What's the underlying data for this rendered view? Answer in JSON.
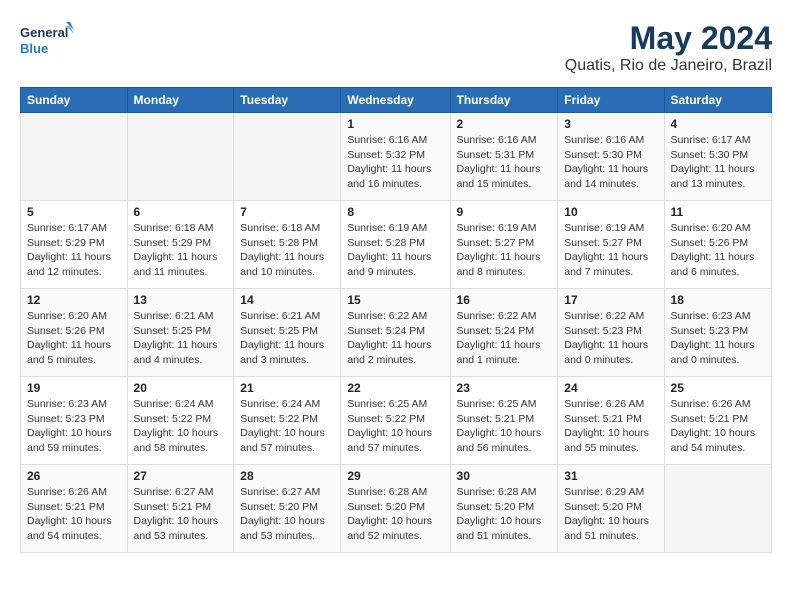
{
  "logo": {
    "line1": "General",
    "line2": "Blue"
  },
  "header": {
    "title": "May 2024",
    "subtitle": "Quatis, Rio de Janeiro, Brazil"
  },
  "calendar": {
    "days_of_week": [
      "Sunday",
      "Monday",
      "Tuesday",
      "Wednesday",
      "Thursday",
      "Friday",
      "Saturday"
    ],
    "weeks": [
      [
        {
          "day": "",
          "info": ""
        },
        {
          "day": "",
          "info": ""
        },
        {
          "day": "",
          "info": ""
        },
        {
          "day": "1",
          "info": "Sunrise: 6:16 AM\nSunset: 5:32 PM\nDaylight: 11 hours and 16 minutes."
        },
        {
          "day": "2",
          "info": "Sunrise: 6:16 AM\nSunset: 5:31 PM\nDaylight: 11 hours and 15 minutes."
        },
        {
          "day": "3",
          "info": "Sunrise: 6:16 AM\nSunset: 5:30 PM\nDaylight: 11 hours and 14 minutes."
        },
        {
          "day": "4",
          "info": "Sunrise: 6:17 AM\nSunset: 5:30 PM\nDaylight: 11 hours and 13 minutes."
        }
      ],
      [
        {
          "day": "5",
          "info": "Sunrise: 6:17 AM\nSunset: 5:29 PM\nDaylight: 11 hours and 12 minutes."
        },
        {
          "day": "6",
          "info": "Sunrise: 6:18 AM\nSunset: 5:29 PM\nDaylight: 11 hours and 11 minutes."
        },
        {
          "day": "7",
          "info": "Sunrise: 6:18 AM\nSunset: 5:28 PM\nDaylight: 11 hours and 10 minutes."
        },
        {
          "day": "8",
          "info": "Sunrise: 6:19 AM\nSunset: 5:28 PM\nDaylight: 11 hours and 9 minutes."
        },
        {
          "day": "9",
          "info": "Sunrise: 6:19 AM\nSunset: 5:27 PM\nDaylight: 11 hours and 8 minutes."
        },
        {
          "day": "10",
          "info": "Sunrise: 6:19 AM\nSunset: 5:27 PM\nDaylight: 11 hours and 7 minutes."
        },
        {
          "day": "11",
          "info": "Sunrise: 6:20 AM\nSunset: 5:26 PM\nDaylight: 11 hours and 6 minutes."
        }
      ],
      [
        {
          "day": "12",
          "info": "Sunrise: 6:20 AM\nSunset: 5:26 PM\nDaylight: 11 hours and 5 minutes."
        },
        {
          "day": "13",
          "info": "Sunrise: 6:21 AM\nSunset: 5:25 PM\nDaylight: 11 hours and 4 minutes."
        },
        {
          "day": "14",
          "info": "Sunrise: 6:21 AM\nSunset: 5:25 PM\nDaylight: 11 hours and 3 minutes."
        },
        {
          "day": "15",
          "info": "Sunrise: 6:22 AM\nSunset: 5:24 PM\nDaylight: 11 hours and 2 minutes."
        },
        {
          "day": "16",
          "info": "Sunrise: 6:22 AM\nSunset: 5:24 PM\nDaylight: 11 hours and 1 minute."
        },
        {
          "day": "17",
          "info": "Sunrise: 6:22 AM\nSunset: 5:23 PM\nDaylight: 11 hours and 0 minutes."
        },
        {
          "day": "18",
          "info": "Sunrise: 6:23 AM\nSunset: 5:23 PM\nDaylight: 11 hours and 0 minutes."
        }
      ],
      [
        {
          "day": "19",
          "info": "Sunrise: 6:23 AM\nSunset: 5:23 PM\nDaylight: 10 hours and 59 minutes."
        },
        {
          "day": "20",
          "info": "Sunrise: 6:24 AM\nSunset: 5:22 PM\nDaylight: 10 hours and 58 minutes."
        },
        {
          "day": "21",
          "info": "Sunrise: 6:24 AM\nSunset: 5:22 PM\nDaylight: 10 hours and 57 minutes."
        },
        {
          "day": "22",
          "info": "Sunrise: 6:25 AM\nSunset: 5:22 PM\nDaylight: 10 hours and 57 minutes."
        },
        {
          "day": "23",
          "info": "Sunrise: 6:25 AM\nSunset: 5:21 PM\nDaylight: 10 hours and 56 minutes."
        },
        {
          "day": "24",
          "info": "Sunrise: 6:26 AM\nSunset: 5:21 PM\nDaylight: 10 hours and 55 minutes."
        },
        {
          "day": "25",
          "info": "Sunrise: 6:26 AM\nSunset: 5:21 PM\nDaylight: 10 hours and 54 minutes."
        }
      ],
      [
        {
          "day": "26",
          "info": "Sunrise: 6:26 AM\nSunset: 5:21 PM\nDaylight: 10 hours and 54 minutes."
        },
        {
          "day": "27",
          "info": "Sunrise: 6:27 AM\nSunset: 5:21 PM\nDaylight: 10 hours and 53 minutes."
        },
        {
          "day": "28",
          "info": "Sunrise: 6:27 AM\nSunset: 5:20 PM\nDaylight: 10 hours and 53 minutes."
        },
        {
          "day": "29",
          "info": "Sunrise: 6:28 AM\nSunset: 5:20 PM\nDaylight: 10 hours and 52 minutes."
        },
        {
          "day": "30",
          "info": "Sunrise: 6:28 AM\nSunset: 5:20 PM\nDaylight: 10 hours and 51 minutes."
        },
        {
          "day": "31",
          "info": "Sunrise: 6:29 AM\nSunset: 5:20 PM\nDaylight: 10 hours and 51 minutes."
        },
        {
          "day": "",
          "info": ""
        }
      ]
    ]
  }
}
